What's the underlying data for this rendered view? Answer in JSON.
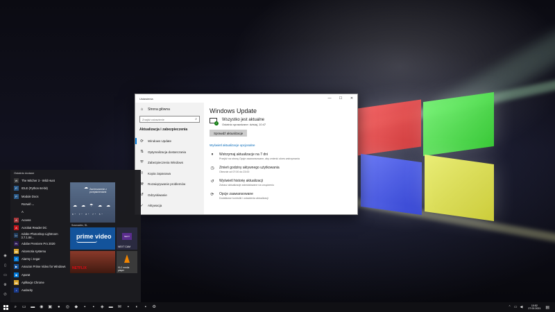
{
  "settings_window": {
    "title": "Ustawienia",
    "controls": [
      "—",
      "☐",
      "✕"
    ],
    "sidebar": {
      "home": "Strona główna",
      "search_placeholder": "Znajdź ustawienie",
      "section": "Aktualizacja i zabezpieczenia",
      "items": [
        {
          "label": "Windows Update",
          "icon": "refresh-icon",
          "glyph": "⟳"
        },
        {
          "label": "Optymalizacja dostarczania",
          "icon": "delivery-icon",
          "glyph": "⇅"
        },
        {
          "label": "Zabezpieczenia Windows",
          "icon": "shield-icon",
          "glyph": "⛨"
        },
        {
          "label": "Kopia zapasowa",
          "icon": "backup-icon",
          "glyph": "⇧"
        },
        {
          "label": "Rozwiązywanie problemów",
          "icon": "wrench-icon",
          "glyph": "⚒"
        },
        {
          "label": "Odzyskiwanie",
          "icon": "recovery-icon",
          "glyph": "↺"
        },
        {
          "label": "Aktywacja",
          "icon": "activation-icon",
          "glyph": "✓"
        }
      ]
    },
    "main": {
      "heading": "Windows Update",
      "status_title": "Wszystko jest aktualne",
      "status_subtitle": "Ostatnio sprawdzane: dzisiaj, 10:47",
      "check_button": "Sprawdź aktualizacje",
      "optional_link": "Wyświetl aktualizacje opcjonalne",
      "options": [
        {
          "title": "Wstrzymaj aktualizacje na 7 dni",
          "subtitle": "Przejdź na stronę Opcje zaawansowane, aby zmienić okres wstrzymania",
          "icon": "pause-icon",
          "glyph": "⏸"
        },
        {
          "title": "Zmień godziny aktywnego użytkowania",
          "subtitle": "Obecnie od 07:00 do 23:00",
          "icon": "clock-icon",
          "glyph": "◷"
        },
        {
          "title": "Wyświetl historię aktualizacji",
          "subtitle": "Zobacz aktualizacje zainstalowane na urządzeniu",
          "icon": "history-icon",
          "glyph": "↺"
        },
        {
          "title": "Opcje zaawansowane",
          "subtitle": "Dodatkowe kontrolki i ustawienia aktualizacji",
          "icon": "advanced-options-icon",
          "glyph": "⟳"
        }
      ]
    }
  },
  "start_menu": {
    "recent_header": "Ostatnio dodane",
    "apps": [
      {
        "label": "The Witcher 3 - Wild Hunt",
        "color": "#3a3a3a",
        "glyph": "W"
      },
      {
        "label": "IDLE (Python 64-bit)",
        "color": "#2b5b8a",
        "glyph": "P"
      },
      {
        "label": "Module Docs",
        "color": "#2b5b8a",
        "glyph": "P"
      },
      {
        "label": "Rozwiń ⌄",
        "color": "transparent",
        "glyph": ""
      },
      {
        "label": "A",
        "color": "transparent",
        "glyph": ""
      },
      {
        "label": "Access",
        "color": "#a4373a",
        "glyph": "A"
      },
      {
        "label": "Acrobat Reader DC",
        "color": "#c4161c",
        "glyph": "A"
      },
      {
        "label": "Adobe Photoshop Lightroom 3.7.1.84...",
        "color": "#1e3a5a",
        "glyph": "Lr"
      },
      {
        "label": "Adobe Premiere Pro 2020",
        "color": "#2a1a50",
        "glyph": "Pr"
      },
      {
        "label": "Akcesoria systemu",
        "color": "#d9a62e",
        "glyph": "▬"
      },
      {
        "label": "Alarmy i zegar",
        "color": "#0078d7",
        "glyph": "◷"
      },
      {
        "label": "Amazon Prime Video for Windows",
        "color": "#13539b",
        "glyph": "▶"
      },
      {
        "label": "Aparat",
        "color": "#0078d7",
        "glyph": "◉"
      },
      {
        "label": "Aplikacje Chrome",
        "color": "#d9a62e",
        "glyph": "▬"
      },
      {
        "label": "Audacity",
        "color": "#1a3a8a",
        "glyph": "♪"
      }
    ],
    "tiles": {
      "weather_text": "Zachmurzenie z przejaśnieniami",
      "weather_location": "Sosnowiec, SL",
      "weather_temps": "8°  7°  8°  7°  5°",
      "prime_label": "prime video",
      "next_label": "NEXT CAM",
      "next_badge": "NEXT",
      "netflix_label": "NETFLIX",
      "vlc_label": "VLC media player"
    }
  },
  "taskbar": {
    "icons": [
      {
        "name": "search-icon",
        "glyph": "⌕"
      },
      {
        "name": "task-view-icon",
        "glyph": "▭"
      },
      {
        "name": "file-explorer-icon",
        "glyph": "▬"
      },
      {
        "name": "steam-icon",
        "glyph": "◉"
      },
      {
        "name": "media-icon",
        "glyph": "▣"
      },
      {
        "name": "spotify-icon",
        "glyph": "●"
      },
      {
        "name": "chrome-icon",
        "glyph": "◎"
      },
      {
        "name": "app-icon",
        "glyph": "◆"
      },
      {
        "name": "premiere-icon",
        "glyph": "▪"
      },
      {
        "name": "lightroom-icon",
        "glyph": "▪"
      },
      {
        "name": "app-icon",
        "glyph": "◈"
      },
      {
        "name": "folder-icon",
        "glyph": "▬"
      },
      {
        "name": "mail-icon",
        "glyph": "✉"
      },
      {
        "name": "app-icon",
        "glyph": "▪"
      },
      {
        "name": "app-icon",
        "glyph": "◐"
      },
      {
        "name": "app-icon",
        "glyph": "▪"
      },
      {
        "name": "settings-icon",
        "glyph": "⚙"
      }
    ],
    "time": "10:52",
    "date": "27.02.2021"
  }
}
